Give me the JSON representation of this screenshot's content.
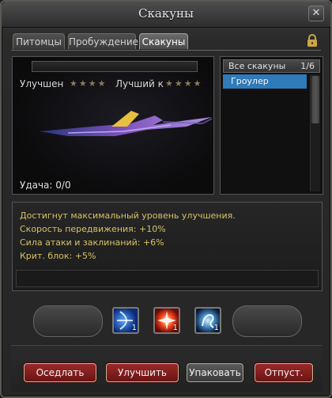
{
  "window": {
    "title": "Скакуны"
  },
  "tabs": [
    {
      "label": "Питомцы"
    },
    {
      "label": "Пробуждение"
    },
    {
      "label": "Скакуны",
      "active": true
    }
  ],
  "preview": {
    "enhanced_label": "Улучшен",
    "enhanced_stars": 4,
    "best_label": "Лучший к",
    "best_stars": 4,
    "luck": "Удача: 0/0"
  },
  "mount_list": {
    "header": "Все скакуны",
    "count": "1/6",
    "items": [
      {
        "label": "Гроулер",
        "selected": true
      }
    ]
  },
  "info": {
    "lines": [
      "Достигнут максимальный уровень улучшения.",
      "Скорость передвижения: +10%",
      "Сила атаки и заклинаний: +6%",
      "Крит. блок: +5%"
    ]
  },
  "skills": [
    {
      "icon": "blue-bow-skill-icon",
      "count": "1"
    },
    {
      "icon": "red-burst-skill-icon",
      "count": "1"
    },
    {
      "icon": "blue-spirit-skill-icon",
      "count": "1"
    }
  ],
  "buttons": {
    "saddle": "Оседлать",
    "upgrade": "Улучшить",
    "pack": "Упаковать",
    "release": "Отпуст."
  },
  "colors": {
    "selected_item": "#2f7ab8",
    "info_text": "#d6c266",
    "danger_button": "#8a2020"
  }
}
